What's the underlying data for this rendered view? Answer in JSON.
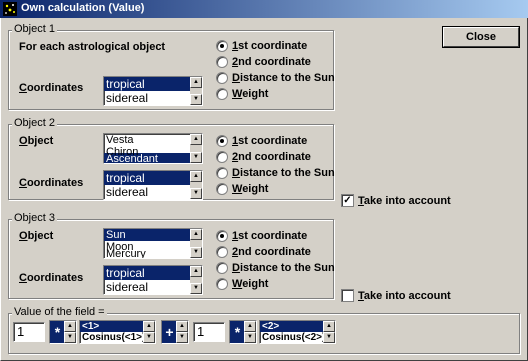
{
  "window": {
    "title": "Own calculation (Value)",
    "close_label": "Close"
  },
  "object1": {
    "group_title": "Object 1",
    "label": "For each astrological object",
    "coord_label": "Coordinates",
    "coord_options": [
      "tropical",
      "sidereal"
    ],
    "coord_selected": 0,
    "radios": [
      "1st coordinate",
      "2nd coordinate",
      "Distance to the Sun",
      "Weight"
    ],
    "radio_selected": 0
  },
  "object2": {
    "group_title": "Object 2",
    "object_label": "Object",
    "objects": [
      "Vesta",
      "Chiron",
      "Ascendant"
    ],
    "object_selected": 2,
    "coord_label": "Coordinates",
    "coord_options": [
      "tropical",
      "sidereal"
    ],
    "coord_selected": 0,
    "radios": [
      "1st coordinate",
      "2nd coordinate",
      "Distance to the Sun",
      "Weight"
    ],
    "radio_selected": 0,
    "take_into_account_label": "Take into account",
    "take_into_account_checked": true
  },
  "object3": {
    "group_title": "Object 3",
    "object_label": "Object",
    "objects": [
      "Sun",
      "Moon",
      "Mercury"
    ],
    "object_selected": 0,
    "coord_label": "Coordinates",
    "coord_options": [
      "tropical",
      "sidereal"
    ],
    "coord_selected": 0,
    "radios": [
      "1st coordinate",
      "2nd coordinate",
      "Distance to the Sun",
      "Weight"
    ],
    "radio_selected": 0,
    "take_into_account_label": "Take into account",
    "take_into_account_checked": false
  },
  "formula": {
    "group_title": "Value of the field =",
    "factor1": "1",
    "op1": "*",
    "term1": [
      "<1>",
      "Cosinus(<1>)"
    ],
    "op_mid": "+",
    "factor2": "1",
    "op2": "*",
    "term2": [
      "<2>",
      "Cosinus(<2>)"
    ]
  },
  "icons": {
    "app": "stars-icon",
    "scroll_up": "scroll-up-arrow",
    "scroll_down": "scroll-down-arrow"
  },
  "colors": {
    "title_bar": "#0a246a",
    "selection": "#0a246a",
    "face": "#d4d0c8"
  }
}
